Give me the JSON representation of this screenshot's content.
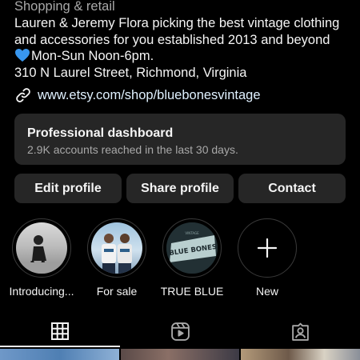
{
  "profile": {
    "category": "Shopping & retail",
    "bio_lines": [
      "Lauren & Jeremy Flora picking the best vintage clothing",
      "and accessories for you established 2013 and beyond",
      "Mon-Sun Noon-6pm.",
      "310 N Laurel Street, Richmond, Virginia"
    ],
    "link": "www.etsy.com/shop/bluebonesvintage"
  },
  "dashboard": {
    "title": "Professional dashboard",
    "subtitle": "2.9K accounts reached in the last 30 days."
  },
  "actions": {
    "edit_label": "Edit profile",
    "share_label": "Share profile",
    "contact_label": "Contact"
  },
  "highlights": [
    {
      "label": "Introducing..."
    },
    {
      "label": "For sale"
    },
    {
      "label": "TRUE BLUE",
      "thumb_text_top": "BLUE BONES",
      "thumb_text_bottom": "VINTAGE"
    },
    {
      "label": "New",
      "icon": "plus-icon"
    }
  ],
  "tabs": [
    {
      "name": "posts-grid",
      "icon": "grid-icon",
      "active": true
    },
    {
      "name": "reels",
      "icon": "reels-icon",
      "active": false
    },
    {
      "name": "tagged",
      "icon": "tagged-icon",
      "active": false
    }
  ],
  "colors": {
    "background": "#000000",
    "surface": "#262626",
    "secondary_text": "#a8a8a8",
    "heart": "#3897f0"
  }
}
